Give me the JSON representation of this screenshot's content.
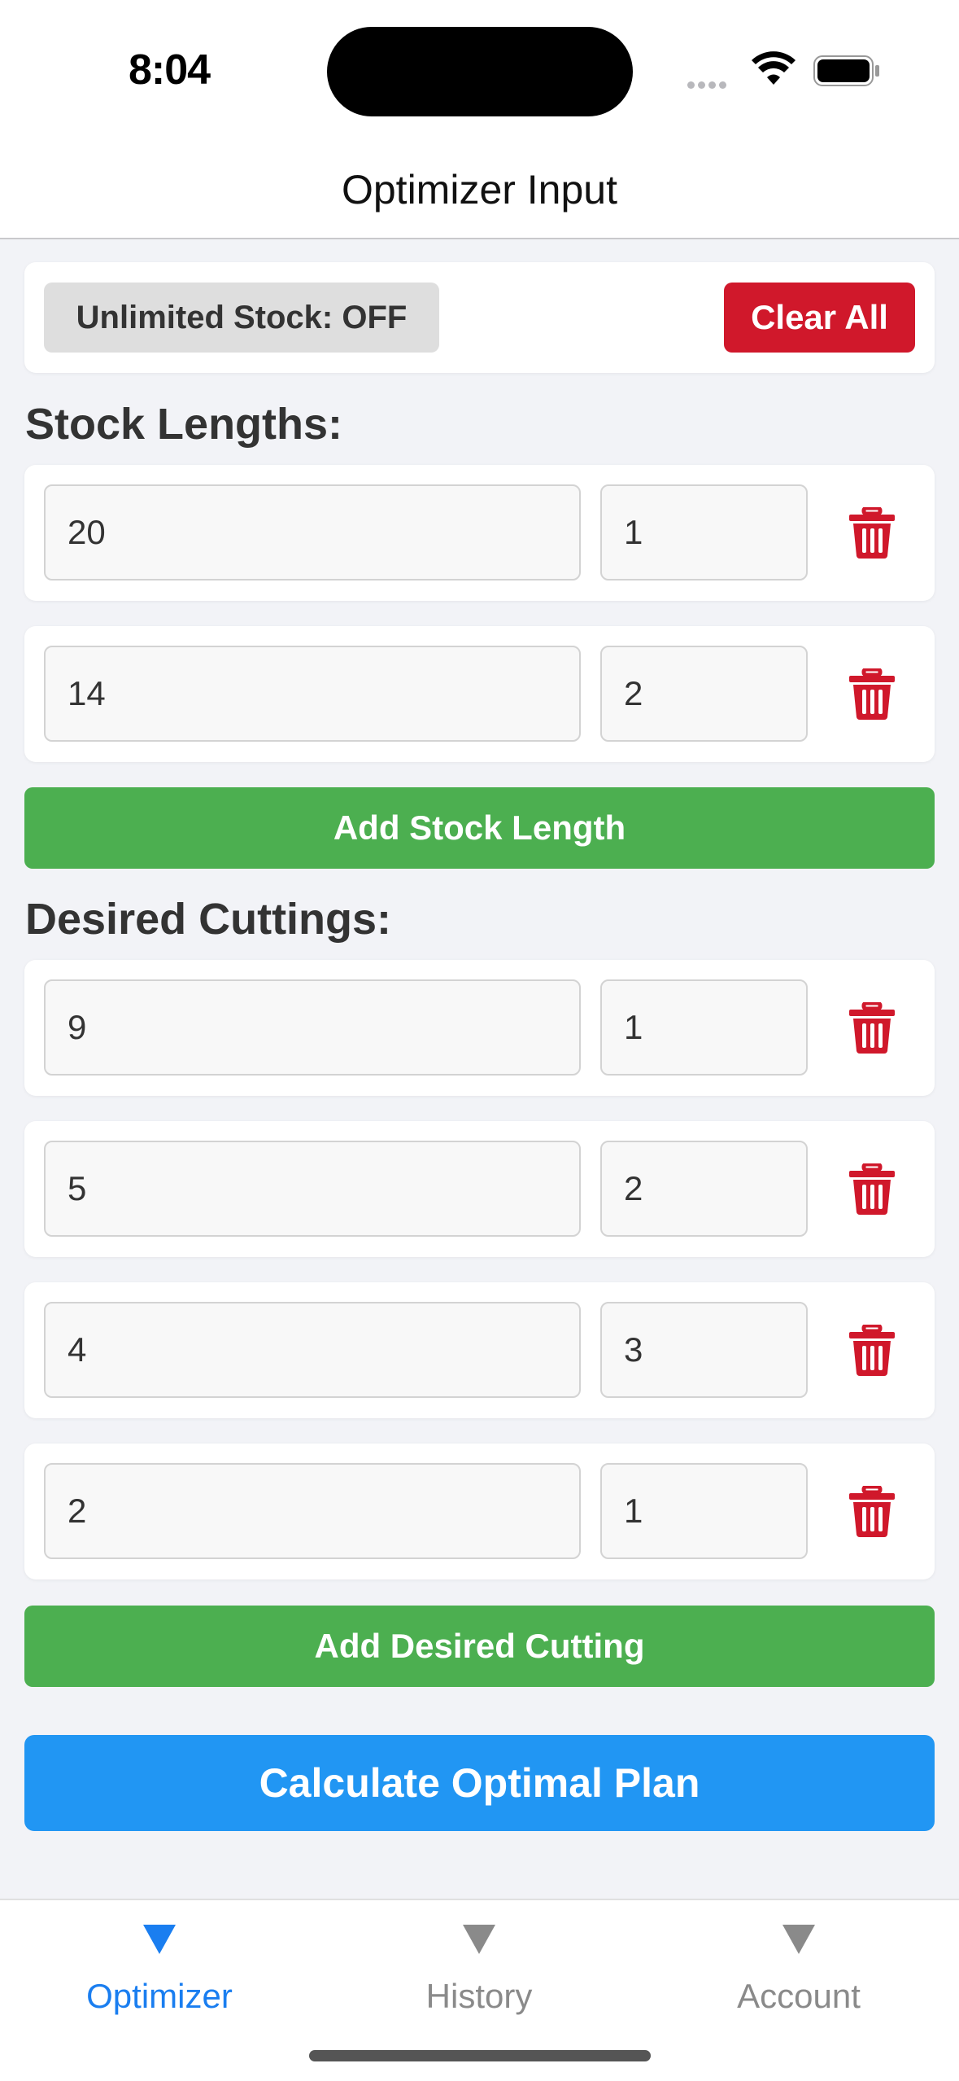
{
  "status_bar": {
    "time": "8:04"
  },
  "header": {
    "title": "Optimizer Input"
  },
  "controls": {
    "unlimited_stock_label": "Unlimited Stock: OFF",
    "clear_all_label": "Clear All"
  },
  "stock_section": {
    "title": "Stock Lengths:",
    "rows": [
      {
        "length": "20",
        "quantity": "1"
      },
      {
        "length": "14",
        "quantity": "2"
      }
    ],
    "add_label": "Add Stock Length"
  },
  "cuttings_section": {
    "title": "Desired Cuttings:",
    "rows": [
      {
        "length": "9",
        "quantity": "1"
      },
      {
        "length": "5",
        "quantity": "2"
      },
      {
        "length": "4",
        "quantity": "3"
      },
      {
        "length": "2",
        "quantity": "1"
      }
    ],
    "add_label": "Add Desired Cutting"
  },
  "calculate_label": "Calculate Optimal Plan",
  "tab_bar": {
    "tabs": [
      {
        "label": "Optimizer",
        "active": true
      },
      {
        "label": "History",
        "active": false
      },
      {
        "label": "Account",
        "active": false
      }
    ]
  },
  "icons": {
    "trash": "trash-icon",
    "tab": "triangle-down-icon"
  },
  "colors": {
    "accent_blue": "#2196f3",
    "danger_red": "#d0182b",
    "success_green": "#4caf50",
    "tab_active": "#1a7ef0"
  }
}
